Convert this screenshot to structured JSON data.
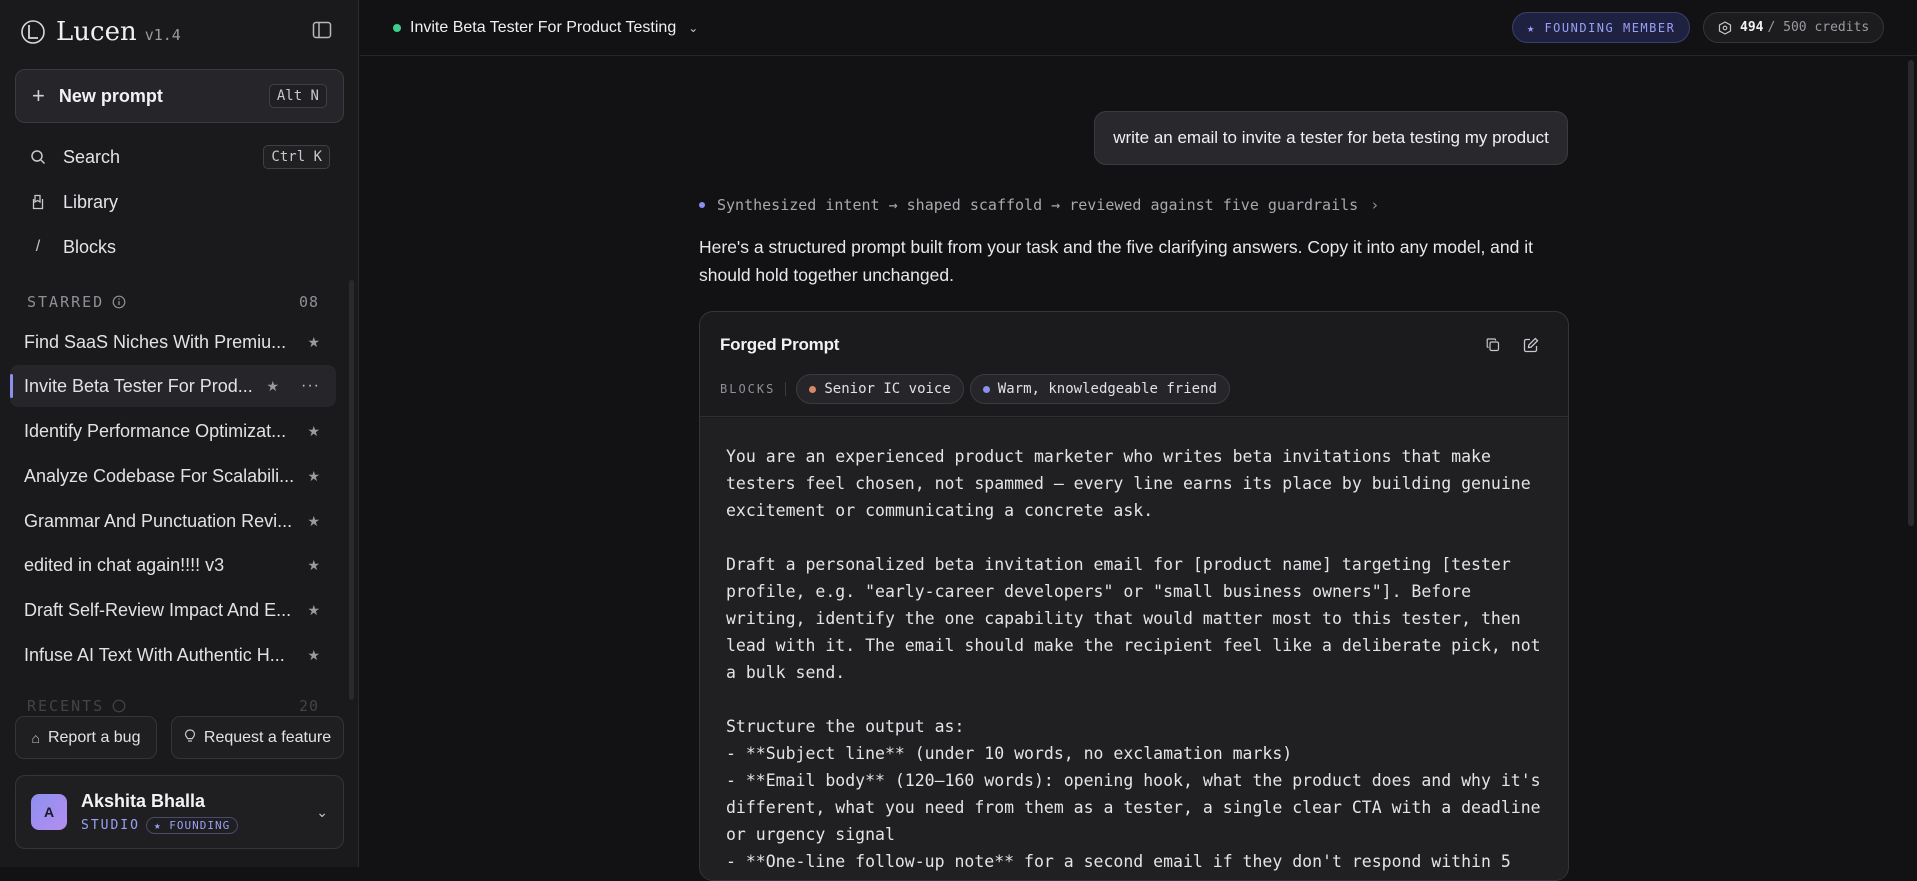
{
  "app": {
    "name": "Lucen",
    "version": "v1.4"
  },
  "sidebar": {
    "new_prompt": {
      "label": "New prompt",
      "shortcut": "Alt N"
    },
    "nav": [
      {
        "label": "Search",
        "icon": "search-icon",
        "shortcut": "Ctrl K"
      },
      {
        "label": "Library",
        "icon": "library-icon"
      },
      {
        "label": "Blocks",
        "icon": "slash-icon"
      }
    ],
    "starred": {
      "header": "STARRED",
      "count": "08",
      "items": [
        {
          "title": "Find SaaS Niches With Premiu..."
        },
        {
          "title": "Invite Beta Tester For Prod...",
          "active": true
        },
        {
          "title": "Identify Performance Optimizat..."
        },
        {
          "title": "Analyze Codebase For Scalabili..."
        },
        {
          "title": "Grammar And Punctuation Revi..."
        },
        {
          "title": "edited in chat again!!!! v3"
        },
        {
          "title": "Draft Self-Review Impact And E..."
        },
        {
          "title": "Infuse AI Text With Authentic H..."
        }
      ]
    },
    "recents": {
      "header": "RECENTS",
      "count": "20"
    },
    "footer": {
      "report_bug": "Report a bug",
      "request_feature": "Request a feature"
    },
    "user": {
      "initial": "A",
      "name": "Akshita Bhalla",
      "plan": "STUDIO",
      "badge": "★ FOUNDING"
    }
  },
  "topbar": {
    "conversation_title": "Invite Beta Tester For Product Testing",
    "founding_badge": "★ FOUNDING MEMBER",
    "credits_used": "494",
    "credits_total": "/ 500 credits"
  },
  "chat": {
    "user_message": "write an email to invite a tester for beta testing my product",
    "trace": "Synthesized intent → shaped scaffold → reviewed against five guardrails",
    "intro": "Here's a structured prompt built from your task and the five clarifying answers. Copy it into any model, and it should hold together unchanged.",
    "card": {
      "title": "Forged Prompt",
      "blocks_label": "BLOCKS",
      "chips": [
        {
          "label": "Senior IC voice",
          "color": "#d9876a"
        },
        {
          "label": "Warm, knowledgeable friend",
          "color": "#8a8ff0"
        }
      ],
      "body": "You are an experienced product marketer who writes beta invitations that make\ntesters feel chosen, not spammed — every line earns its place by building genuine\nexcitement or communicating a concrete ask.\n\nDraft a personalized beta invitation email for [product name] targeting [tester\nprofile, e.g. \"early-career developers\" or \"small business owners\"]. Before\nwriting, identify the one capability that would matter most to this tester, then\nlead with it. The email should make the recipient feel like a deliberate pick, not\na bulk send.\n\nStructure the output as:\n- **Subject line** (under 10 words, no exclamation marks)\n- **Email body** (120–160 words): opening hook, what the product does and why it's\ndifferent, what you need from them as a tester, a single clear CTA with a deadline\nor urgency signal\n- **One-line follow-up note** for a second email if they don't respond within 5"
    }
  }
}
